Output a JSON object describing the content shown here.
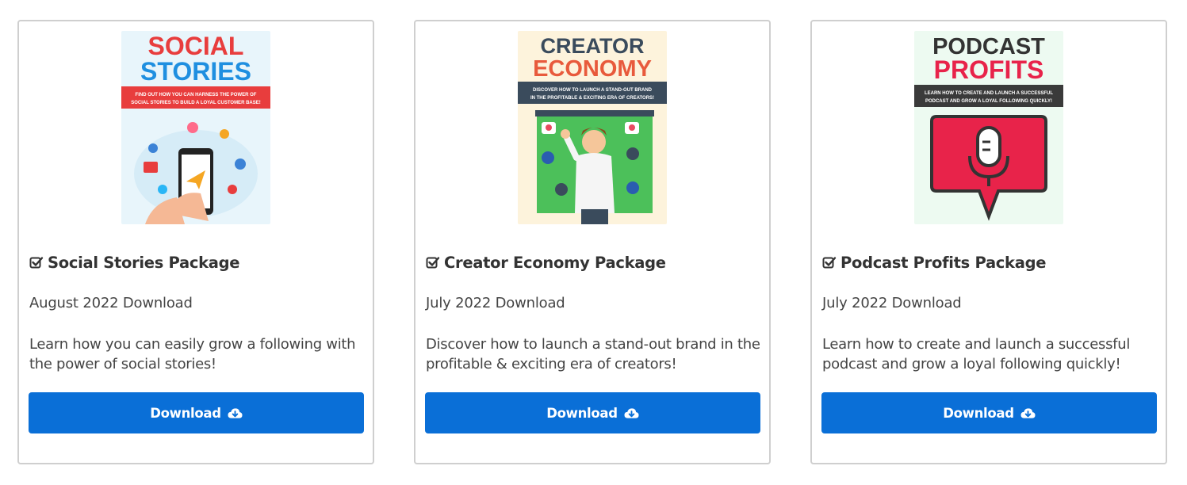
{
  "cards": [
    {
      "title": "Social Stories Package",
      "date": "August 2022 Download",
      "description": "Learn how you can easily grow a following with the power of social stories!",
      "button": "Download",
      "cover": {
        "line1": "SOCIAL",
        "line2": "STORIES",
        "banner1": "FIND OUT HOW YOU CAN HARNESS THE POWER OF",
        "banner2": "SOCIAL STORIES TO BUILD A LOYAL CUSTOMER BASE!",
        "bg": "#e8f5fb",
        "color1": "#e83d3d",
        "color2": "#1f8fe0",
        "banner_bg": "#e83d3d"
      }
    },
    {
      "title": "Creator Economy Package",
      "date": "July 2022 Download",
      "description": "Discover how to launch a stand-out brand in the profitable & exciting era of creators!",
      "button": "Download",
      "cover": {
        "line1": "CREATOR",
        "line2": "ECONOMY",
        "banner1": "DISCOVER HOW TO LAUNCH A STAND-OUT BRAND",
        "banner2": "IN THE PROFITABLE & EXCITING ERA OF CREATORS!",
        "bg": "#fdf3dc",
        "color1": "#3a4b5c",
        "color2": "#e85a3c",
        "banner_bg": "#3a4b5c"
      }
    },
    {
      "title": "Podcast Profits Package",
      "date": "July 2022 Download",
      "description": "Learn how to create and launch a successful podcast and grow a loyal following quickly!",
      "button": "Download",
      "cover": {
        "line1": "PODCAST",
        "line2": "PROFITS",
        "banner1": "LEARN HOW TO CREATE AND LAUNCH A SUCCESSFUL",
        "banner2": "PODCAST AND GROW A LOYAL FOLLOWING QUICKLY!",
        "bg": "#edfaf1",
        "color1": "#333333",
        "color2": "#e8234a",
        "banner_bg": "#3a3a3a"
      }
    }
  ],
  "colors": {
    "button_bg": "#0a6fd7",
    "border": "#cfcfcf",
    "text": "#333333"
  }
}
